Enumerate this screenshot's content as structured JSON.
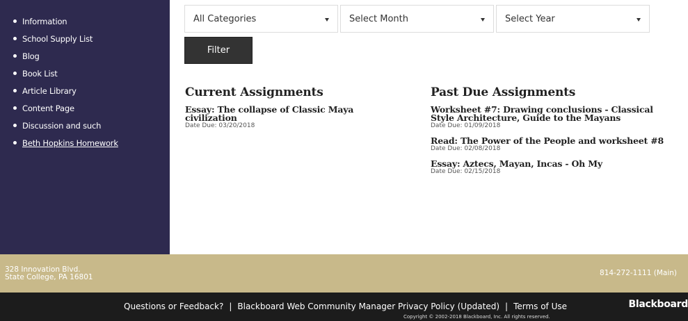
{
  "sidebar": {
    "items": [
      {
        "label": "Information"
      },
      {
        "label": "School Supply List"
      },
      {
        "label": "Blog"
      },
      {
        "label": "Book List"
      },
      {
        "label": "Article Library"
      },
      {
        "label": "Content Page"
      },
      {
        "label": "Discussion and such"
      },
      {
        "label": "Beth Hopkins Homework"
      }
    ]
  },
  "filters": {
    "category": "All Categories",
    "month": "Select Month",
    "year": "Select Year",
    "filter_label": "Filter"
  },
  "current": {
    "heading": "Current Assignments",
    "items": [
      {
        "title": "Essay: The collapse of Classic Maya civilization",
        "due": "Date Due: 03/20/2018"
      }
    ]
  },
  "past": {
    "heading": "Past Due Assignments",
    "items": [
      {
        "title": "Worksheet #7: Drawing conclusions - Classical Style Architecture, Guide to the Mayans",
        "due": "Date Due: 01/09/2018"
      },
      {
        "title": "Read: The Power of the People and worksheet #8",
        "due": "Date Due: 02/08/2018"
      },
      {
        "title": "Essay: Aztecs, Mayan, Incas - Oh My",
        "due": "Date Due: 02/15/2018"
      }
    ]
  },
  "footer": {
    "address_line1": "328 Innovation Blvd.",
    "address_line2": "State College, PA 16801",
    "phone": "814-272-1111 (Main)",
    "link_feedback": "Questions or Feedback?",
    "link_privacy": "Blackboard Web Community Manager Privacy Policy (Updated)",
    "link_terms": "Terms of Use",
    "separator": "|",
    "copyright": "Copyright © 2002-2018 Blackboard, Inc. All rights reserved.",
    "brand": "Blackboard"
  },
  "colors": {
    "sidebar_bg": "#2e2a4f",
    "footer_tan": "#c8b98a",
    "footer_dark": "#1c1c1c",
    "button_bg": "#333333"
  }
}
